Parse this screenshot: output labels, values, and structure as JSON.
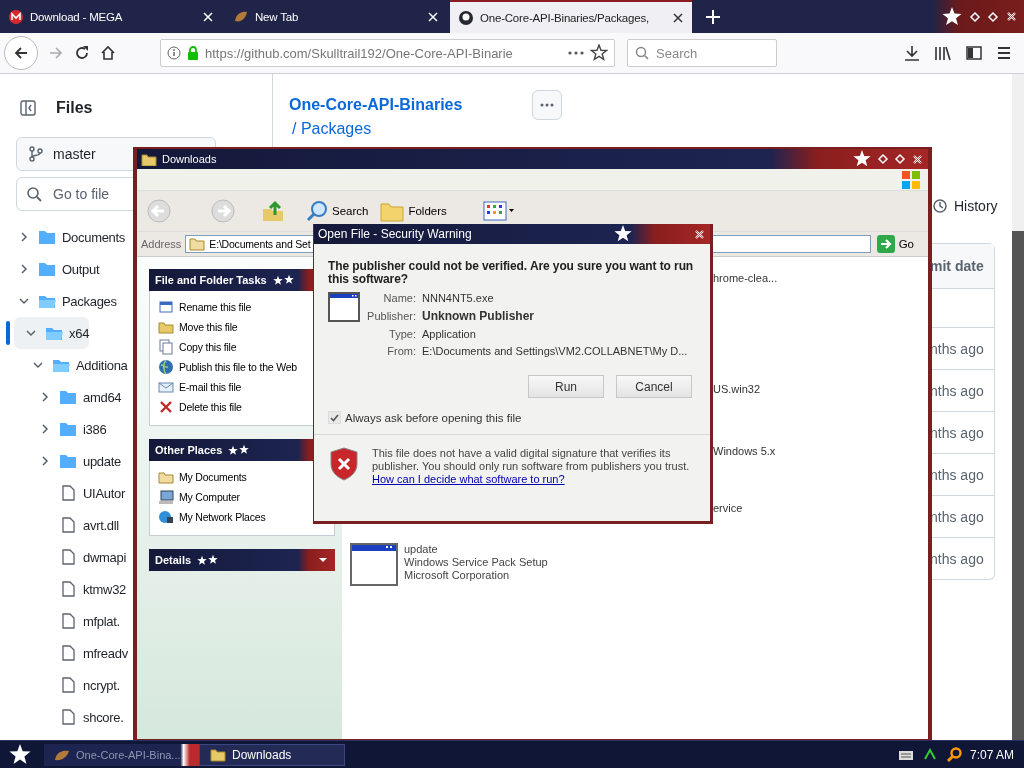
{
  "browser": {
    "tabs": [
      {
        "title": "Download - MEGA",
        "selected": false
      },
      {
        "title": "New Tab",
        "selected": false
      },
      {
        "title": "One-Core-API-Binaries/Packages,",
        "selected": true
      }
    ],
    "url_host": "https://github.com/",
    "url_path": "Skulltrail192/One-Core-API-Binarie",
    "search": {
      "placeholder": "Search"
    }
  },
  "github": {
    "sidebar_title": "Files",
    "branch": "master",
    "go_to_file": {
      "placeholder": "Go to file"
    },
    "tree": [
      {
        "kind": "folder",
        "name": "Documents",
        "expanded": false,
        "selected": false
      },
      {
        "kind": "folder",
        "name": "Output",
        "expanded": false,
        "selected": false
      },
      {
        "kind": "folder",
        "name": "Packages",
        "expanded": true,
        "selected": false,
        "children": [
          {
            "kind": "folder",
            "name": "x64",
            "expanded": true,
            "selected": true,
            "children": [
              {
                "kind": "folder",
                "name": "Additiona",
                "expanded": true,
                "selected": false,
                "children": [
                  {
                    "kind": "folder",
                    "name": "amd64",
                    "expanded": false,
                    "selected": false
                  },
                  {
                    "kind": "folder",
                    "name": "i386",
                    "expanded": false,
                    "selected": false
                  },
                  {
                    "kind": "folder",
                    "name": "update",
                    "expanded": false,
                    "selected": false
                  },
                  {
                    "kind": "file",
                    "name": "UIAutor",
                    "selected": false
                  },
                  {
                    "kind": "file",
                    "name": "avrt.dll",
                    "selected": false
                  },
                  {
                    "kind": "file",
                    "name": "dwmapi",
                    "selected": false
                  },
                  {
                    "kind": "file",
                    "name": "ktmw32",
                    "selected": false
                  },
                  {
                    "kind": "file",
                    "name": "mfplat.",
                    "selected": false
                  },
                  {
                    "kind": "file",
                    "name": "mfreadv",
                    "selected": false
                  },
                  {
                    "kind": "file",
                    "name": "ncrypt.",
                    "selected": false
                  },
                  {
                    "kind": "file",
                    "name": "shcore.",
                    "selected": false
                  }
                ]
              }
            ]
          }
        ]
      }
    ],
    "repo": "One-Core-API-Binaries",
    "breadcrumb": "/ Packages",
    "history": "History",
    "table": {
      "column": "mit date",
      "rows": [
        "",
        "nths ago",
        "nths ago",
        "nths ago",
        "nths ago",
        "nths ago",
        "nths ago"
      ]
    }
  },
  "explorer": {
    "title": "Downloads",
    "toolbar": [
      "Search",
      "Folders"
    ],
    "address_label": "Address",
    "address": "E:\\Documents and Set",
    "go": "Go",
    "panels": [
      {
        "title": "File and Folder Tasks",
        "items": [
          "Rename this file",
          "Move this file",
          "Copy this file",
          "Publish this file to the Web",
          "E-mail this file",
          "Delete this file"
        ]
      },
      {
        "title": "Other Places",
        "items": [
          "My Documents",
          "My Computer",
          "My Network Places"
        ]
      },
      {
        "title": "Details"
      }
    ],
    "file_fragments": [
      "hrome-clea...",
      "US.win32",
      "Windows 5.x",
      "ervice"
    ],
    "file": {
      "name": "update",
      "description": "Windows Service Pack Setup",
      "company": "Microsoft Corporation"
    }
  },
  "dialog": {
    "title": "Open File - Security Warning",
    "question": "The publisher could not be verified.  Are you sure you want to run this software?",
    "fields": [
      {
        "label": "Name:",
        "value": "NNN4NT5.exe"
      },
      {
        "label": "Publisher:",
        "value": "Unknown Publisher"
      },
      {
        "label": "Type:",
        "value": "Application"
      },
      {
        "label": "From:",
        "value": "E:\\Documents and Settings\\VM2.COLLABNET\\My D..."
      }
    ],
    "buttons": [
      "Run",
      "Cancel"
    ],
    "always_ask": {
      "label": "Always ask before opening this file",
      "checked": true
    },
    "warning": "This file does not have a valid digital signature that verifies its publisher.  You should only run software from publishers you trust.",
    "link": "How can I decide what software to run?"
  },
  "taskbar": {
    "tasks": [
      {
        "title": "One-Core-API-Bina...",
        "selected": false
      },
      {
        "title": "Downloads",
        "selected": true
      }
    ],
    "clock": "7:07 AM"
  }
}
